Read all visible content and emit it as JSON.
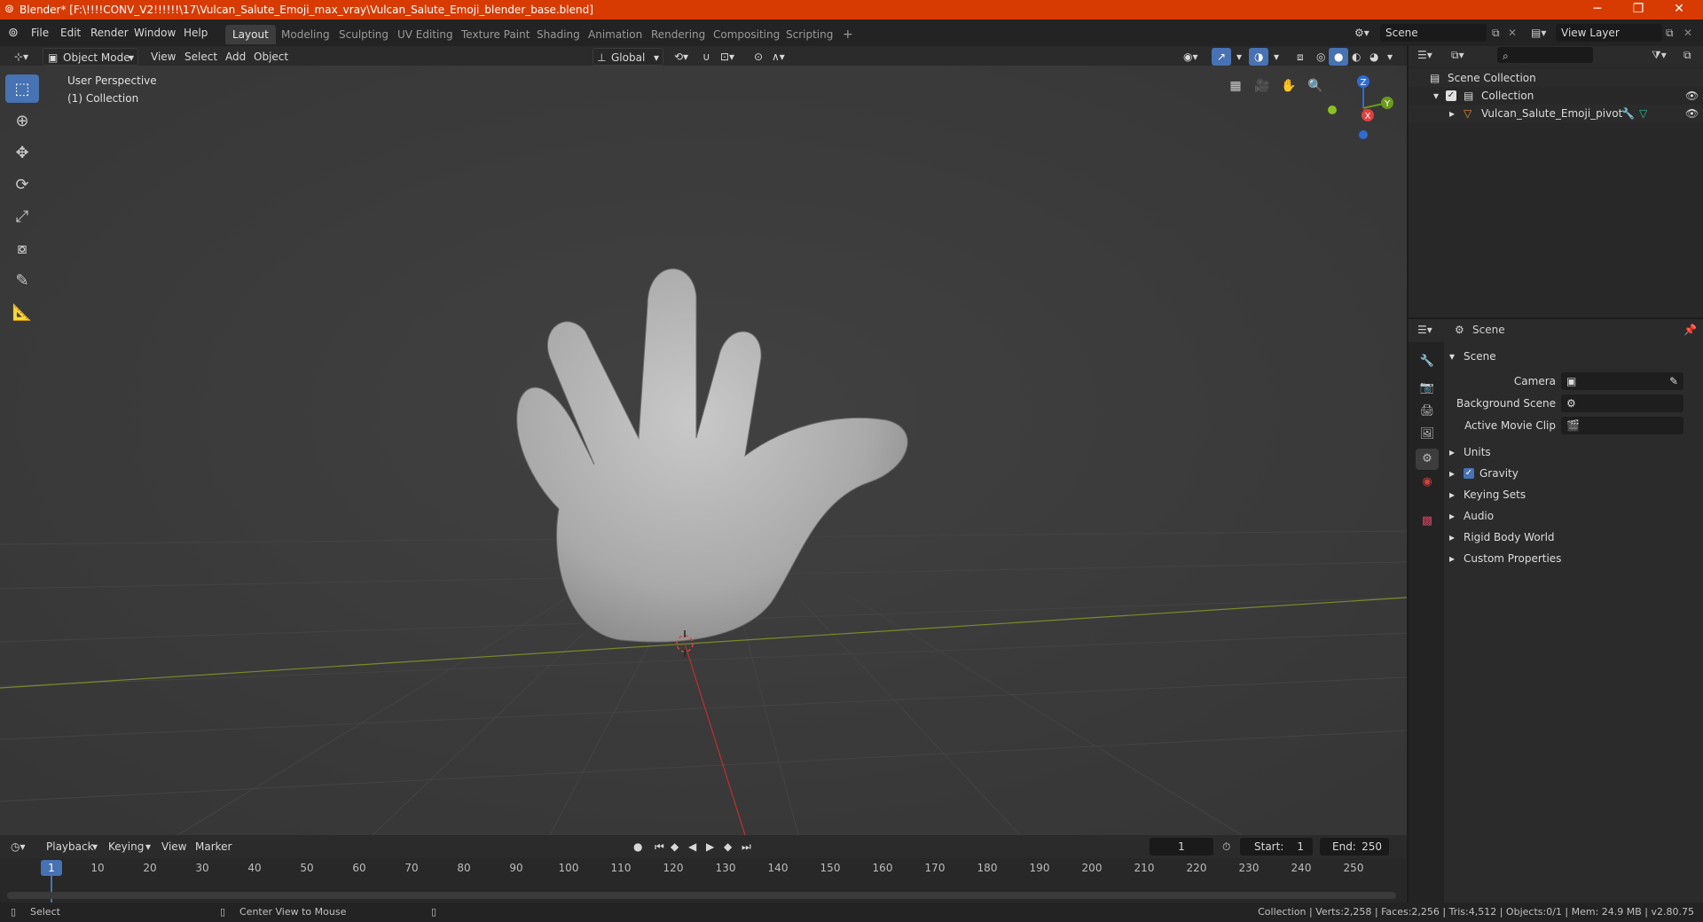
{
  "window": {
    "title": "Blender* [F:\\!!!!CONV_V2!!!!!!\\17\\Vulcan_Salute_Emoji_max_vray\\Vulcan_Salute_Emoji_blender_base.blend]",
    "minimize": "─",
    "maximize": "❐",
    "close": "✕"
  },
  "menu": {
    "file": "File",
    "edit": "Edit",
    "render": "Render",
    "window": "Window",
    "help": "Help"
  },
  "workspaces": [
    "Layout",
    "Modeling",
    "Sculpting",
    "UV Editing",
    "Texture Paint",
    "Shading",
    "Animation",
    "Rendering",
    "Compositing",
    "Scripting"
  ],
  "workspace_add": "+",
  "scene_field": "Scene",
  "viewlayer_field": "View Layer",
  "viewport_header": {
    "mode": "Object Mode",
    "view": "View",
    "select": "Select",
    "add": "Add",
    "object": "Object",
    "orientation": "Global"
  },
  "viewport": {
    "perspective": "User Perspective",
    "collection": "(1) Collection",
    "gizmo": {
      "z": "Z",
      "y": "Y",
      "x": "X"
    }
  },
  "timeline": {
    "playback": "Playback",
    "keying": "Keying",
    "view": "View",
    "marker": "Marker",
    "current_frame": "1",
    "start_label": "Start:",
    "start": "1",
    "end_label": "End:",
    "end": "250",
    "ticks": [
      "1",
      "10",
      "20",
      "30",
      "40",
      "50",
      "60",
      "70",
      "80",
      "90",
      "100",
      "110",
      "120",
      "130",
      "140",
      "150",
      "160",
      "170",
      "180",
      "190",
      "200",
      "210",
      "220",
      "230",
      "240",
      "250"
    ]
  },
  "statusbar": {
    "select": "Select",
    "center_view": "Center View to Mouse",
    "stats": "Collection | Verts:2,258 | Faces:2,256 | Tris:4,512 | Objects:0/1 | Mem: 24.9 MB | v2.80.75"
  },
  "outliner": {
    "scene_collection": "Scene Collection",
    "collection": "Collection",
    "object": "Vulcan_Salute_Emoji_pivot"
  },
  "properties": {
    "header": "Scene",
    "section": "Scene",
    "camera_label": "Camera",
    "background_scene_label": "Background Scene",
    "active_movie_clip_label": "Active Movie Clip",
    "panels": [
      "Units",
      "Gravity",
      "Keying Sets",
      "Audio",
      "Rigid Body World",
      "Custom Properties"
    ]
  }
}
